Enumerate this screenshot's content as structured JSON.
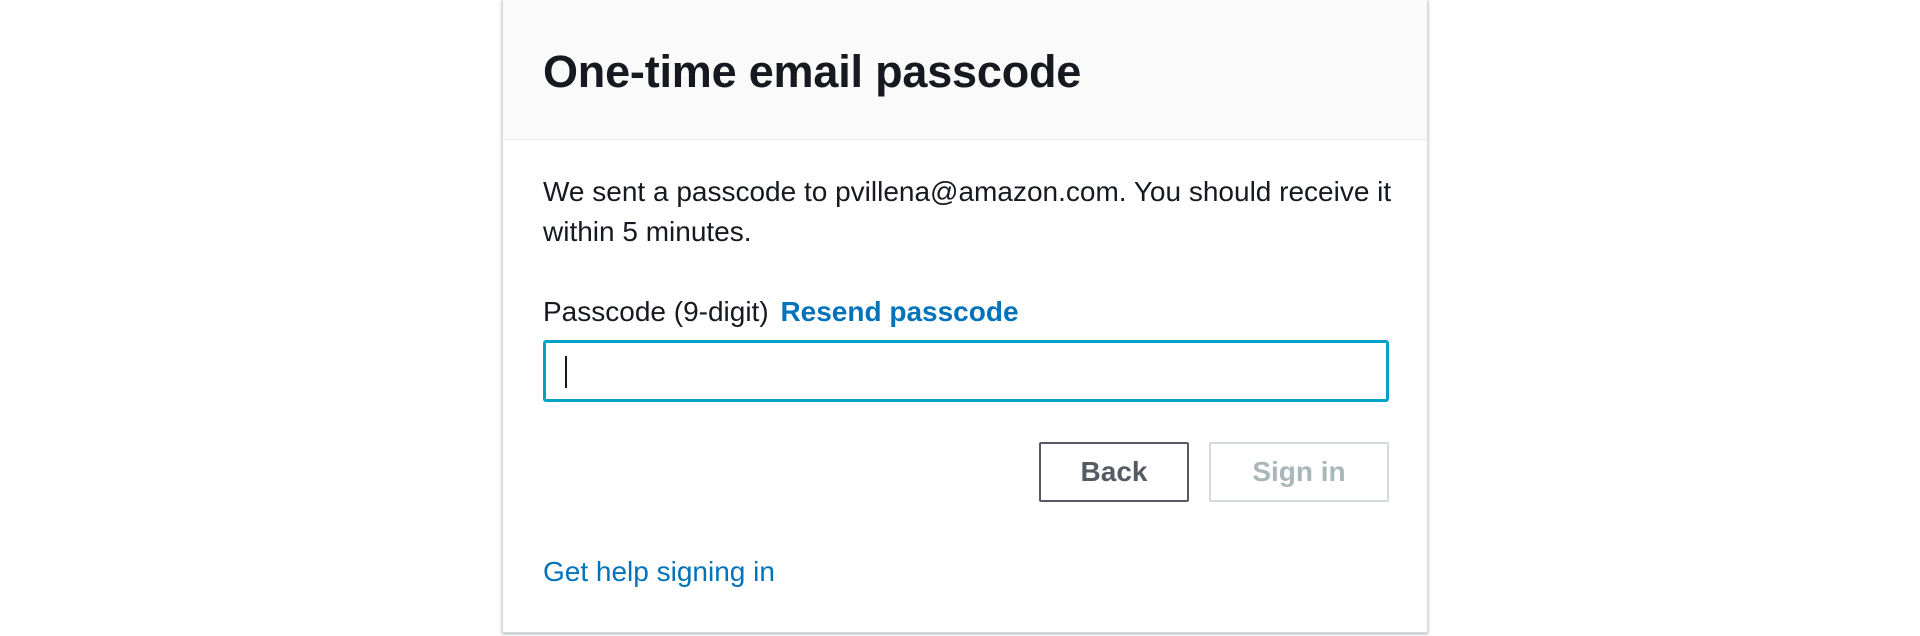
{
  "dialog": {
    "title": "One-time email passcode",
    "message": "We sent a passcode to pvillena@amazon.com. You should receive it within 5 minutes.",
    "passcode_label": "Passcode (9-digit)",
    "resend_link": "Resend passcode",
    "passcode_value": "",
    "back_button": "Back",
    "signin_button": "Sign in",
    "help_link": "Get help signing in"
  },
  "colors": {
    "link": "#0073bb",
    "input_focus_border": "#00a1c9",
    "header_background": "#fafafa",
    "disabled_text": "#aab7b8",
    "secondary_button_text": "#545b64"
  }
}
